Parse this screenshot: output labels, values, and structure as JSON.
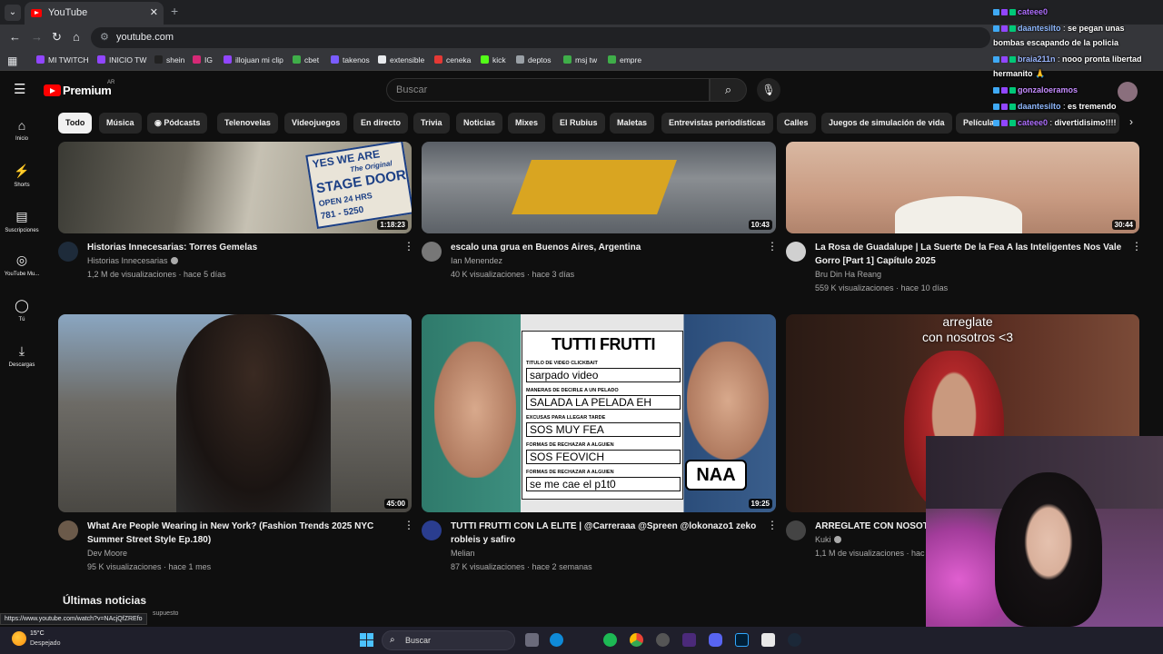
{
  "browser": {
    "tab_title": "YouTube",
    "url": "youtube.com",
    "status_url": "https://www.youtube.com/watch?v=NAcjQfZREfo"
  },
  "bookmarks": [
    {
      "label": "MI TWITCH",
      "color": "#9146ff"
    },
    {
      "label": "INICIO TW",
      "color": "#9146ff"
    },
    {
      "label": "shein",
      "color": "#222222"
    },
    {
      "label": "IG",
      "color": "#d62976"
    },
    {
      "label": "illojuan mi clip",
      "color": "#9146ff"
    },
    {
      "label": "cbet",
      "color": "#3fae49"
    },
    {
      "label": "takenos",
      "color": "#7a5cff"
    },
    {
      "label": "extensible",
      "color": "#e8eaed"
    },
    {
      "label": "ceneka",
      "color": "#e53935"
    },
    {
      "label": "kick",
      "color": "#53fc18"
    },
    {
      "label": "deptos",
      "color": "#9aa0a6"
    },
    {
      "label": "msj tw",
      "color": "#3fae49"
    },
    {
      "label": "empre",
      "color": "#3fae49"
    }
  ],
  "header": {
    "logo": "Premium",
    "logo_region": "AR",
    "search_placeholder": "Buscar"
  },
  "chips": [
    "Todo",
    "Música",
    "Pódcasts",
    "Telenovelas",
    "Videojuegos",
    "En directo",
    "Trivia",
    "Noticias",
    "Mixes",
    "El Rubius",
    "Maletas",
    "Entrevistas periodísticas",
    "Calles",
    "Juegos de simulación de vida",
    "Película"
  ],
  "sidebar": [
    {
      "label": "Inicio",
      "icon": "home-icon"
    },
    {
      "label": "Shorts",
      "icon": "shorts-icon"
    },
    {
      "label": "Suscripciones",
      "icon": "subscriptions-icon"
    },
    {
      "label": "YouTube Mu...",
      "icon": "youtube-music-icon"
    },
    {
      "label": "Tú",
      "icon": "you-icon"
    },
    {
      "label": "Descargas",
      "icon": "download-icon"
    }
  ],
  "videos": [
    {
      "title": "Historias Innecesarias: Torres Gemelas",
      "title2": "",
      "channel": "Historias Innecesarias",
      "verified": true,
      "meta": "1,2 M de visualizaciones · hace 5 días",
      "duration": "1:18:23",
      "avatar_color": "#1e2b3a"
    },
    {
      "title": "escalo una grua en Buenos Aires, Argentina",
      "title2": "",
      "channel": "Ian Menendez",
      "verified": false,
      "meta": "40 K visualizaciones · hace 3 días",
      "duration": "10:43",
      "avatar_color": "#777777"
    },
    {
      "title": "La Rosa de Guadalupe | La Suerte De la Fea A las Inteligentes Nos Vale",
      "title2": "Gorro  [Part 1] Capítulo 2025",
      "channel": "Bru Din Ha Reang",
      "verified": false,
      "meta": "559 K visualizaciones · hace 10 días",
      "duration": "30:44",
      "avatar_color": "#d0d0d0"
    },
    {
      "title": "What Are People Wearing in New York? (Fashion Trends 2025 NYC",
      "title2": "Summer Street Style Ep.180)",
      "channel": "Dev Moore",
      "verified": false,
      "meta": "95 K visualizaciones · hace 1 mes",
      "duration": "45:00",
      "avatar_color": "#6b5a4a"
    },
    {
      "title": "TUTTI FRUTTI CON LA ELITE | @Carreraaa @Spreen @lokonazo1 zeko",
      "title2": "robleis y safiro",
      "channel": "Melian",
      "verified": false,
      "meta": "87 K visualizaciones · hace 2 semanas",
      "duration": "19:25",
      "avatar_color": "#2a3d8f"
    },
    {
      "title": "ARREGLATE CON NOSOTI",
      "title2": "",
      "channel": "Kuki",
      "verified": true,
      "meta": "1,1 M de visualizaciones · hac",
      "duration": "",
      "avatar_color": "#444444"
    }
  ],
  "thumb_texts": {
    "stage_door": [
      "YES WE ARE",
      "The Original",
      "STAGE DOOR",
      "OPEN 24 HRS",
      "781 - 5250"
    ],
    "tutti_head": "TUTTI FRUTTI",
    "tutti_rows": [
      {
        "label": "TITULO DE VIDEO CLICKBAIT",
        "value": "sarpado video"
      },
      {
        "label": "MANERAS DE DECIRLE A UN PELADO",
        "value": "SALADA LA PELADA EH"
      },
      {
        "label": "EXCUSAS PARA LLEGAR TARDE",
        "value": "SOS MUY FEA"
      },
      {
        "label": "FORMAS DE RECHAZAR A ALGUIEN",
        "value": "SOS FEOVICH"
      },
      {
        "label": "FORMAS DE RECHAZAR A ALGUIEN",
        "value": "se me cae el p1t0"
      }
    ],
    "naa": "NAA",
    "arreglate_caption": "arreglate\ncon nosotros <3"
  },
  "section": {
    "title": "Últimas noticias",
    "sub": "supuesto"
  },
  "chat": [
    {
      "user": "cateee0",
      "msg": "",
      "color": "#b070ff"
    },
    {
      "user": "daantesilto",
      "msg": "se pegan unas",
      "color": "#8fb9ff"
    },
    {
      "user": "",
      "msg": "bombas escapando de la policia",
      "color": "#ffffff"
    },
    {
      "user": "braia211n",
      "msg": "nooo pronta libertad",
      "color": "#9ab6ff"
    },
    {
      "user": "",
      "msg": "hermanito 🙏",
      "color": "#ffffff"
    },
    {
      "user": "gonzaloeramos",
      "msg": "",
      "color": "#c58cff"
    },
    {
      "user": "daantesilto",
      "msg": "es tremendo",
      "color": "#8fb9ff"
    },
    {
      "user": "cateee0",
      "msg": "divertidisimo!!!!",
      "color": "#b070ff"
    }
  ],
  "taskbar": {
    "temp": "15°C",
    "weather": "Despejado",
    "search": "Buscar"
  }
}
